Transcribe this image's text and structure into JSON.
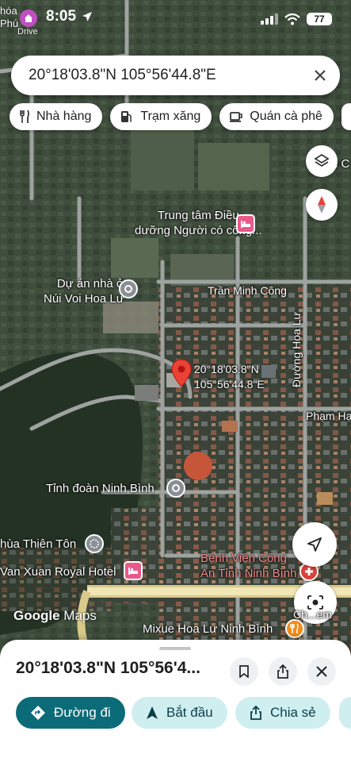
{
  "status_bar": {
    "time": "8:05",
    "left_text_line1": "hóa",
    "left_text_line2": "Phú",
    "left_text_line3": "Drive",
    "battery": "77"
  },
  "search": {
    "query": "20°18'03.8\"N 105°56'44.8\"E"
  },
  "chips": [
    {
      "label": "Nhà hàng",
      "icon": "fork-knife-icon"
    },
    {
      "label": "Trạm xăng",
      "icon": "gas-pump-icon"
    },
    {
      "label": "Quán cà phê",
      "icon": "coffee-cup-icon"
    }
  ],
  "map": {
    "labels": {
      "top_right_fragment": "u C",
      "trung_tam": "Trung tâm Điều\ndưỡng Người có công...",
      "du_an": "Dự án nhà ở\nNúi Voi Hoa Lư",
      "tran_minh_cong": "Trần Minh Công",
      "duong_hoa_lu": "Đường Hoa Lư",
      "pin_coords": "20°18'03.8\"N\n105°56'44.8\"E",
      "pham_hung": "Phạm Hạ",
      "tinh_doan": "Tỉnh đoàn Ninh Bình",
      "chua_thien_ton": "hùa Thiên Tôn",
      "van_xuan": "Van Xuan Royal Hotel",
      "benh_vien": "Bệnh Viện Công\nAn Tỉnh Ninh Bình",
      "mixue": "Mixue Hoa Lư Ninh Bình",
      "ch_em": "Ch...em"
    },
    "logo_google": "Google",
    "logo_maps": "Maps"
  },
  "sheet": {
    "title": "20°18'03.8\"N 105°56'4...",
    "actions": [
      {
        "label": "Đường đi",
        "icon": "directions-icon"
      },
      {
        "label": "Bắt đầu",
        "icon": "navigation-arrow-icon"
      },
      {
        "label": "Chia sẻ",
        "icon": "share-icon"
      }
    ]
  },
  "colors": {
    "primary_action": "#0b6b78",
    "secondary_action": "#cfeef0",
    "pin": "#ea4335"
  }
}
